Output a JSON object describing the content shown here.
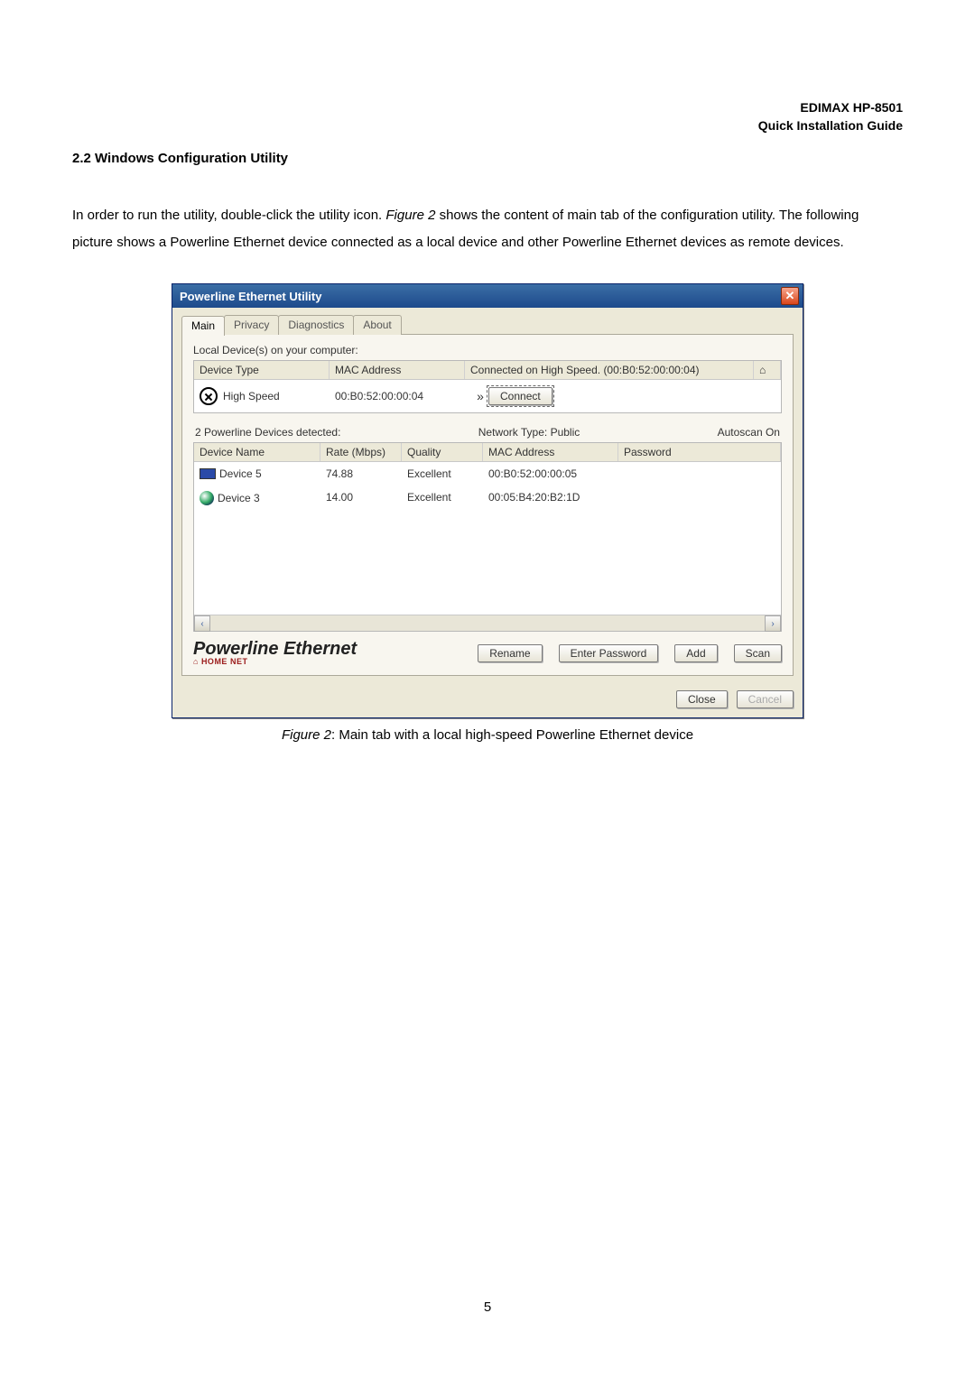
{
  "header": {
    "line1": "EDIMAX  HP-8501",
    "line2": "Quick Installation Guide"
  },
  "section_title": "2.2 Windows Configuration Utility",
  "body_before": "In order to run the utility, double-click the utility icon. ",
  "body_figref": "Figure 2",
  "body_after": " shows the content of main tab of the configuration utility. The following picture shows a Powerline Ethernet device connected as a local device and other Powerline Ethernet devices as remote devices.",
  "caption": {
    "label": "Figure 2",
    "text": ": Main tab with a local high-speed Powerline Ethernet device"
  },
  "page_number": "5",
  "dialog": {
    "title": "Powerline Ethernet Utility",
    "tabs": [
      "Main",
      "Privacy",
      "Diagnostics",
      "About"
    ],
    "local_label": "Local Device(s) on your computer:",
    "local_headers": {
      "type": "Device Type",
      "mac": "MAC Address",
      "status": "Connected on  High Speed. (00:B0:52:00:00:04)"
    },
    "local_row": {
      "type": "High Speed",
      "mac": "00:B0:52:00:00:04",
      "connect": "Connect"
    },
    "status": {
      "detected": "2 Powerline Devices detected:",
      "network": "Network Type: Public",
      "autoscan": "Autoscan On"
    },
    "det_headers": {
      "name": "Device Name",
      "rate": "Rate (Mbps)",
      "quality": "Quality",
      "mac": "MAC Address",
      "password": "Password"
    },
    "devices": [
      {
        "name": "Device 5",
        "rate": "74.88",
        "quality": "Excellent",
        "mac": "00:B0:52:00:00:05",
        "password": ""
      },
      {
        "name": "Device 3",
        "rate": "14.00",
        "quality": "Excellent",
        "mac": "00:05:B4:20:B2:1D",
        "password": ""
      }
    ],
    "brand": {
      "line1": "Powerline Ethernet",
      "line2": "HOME NET"
    },
    "buttons": {
      "rename": "Rename",
      "enter_password": "Enter Password",
      "add": "Add",
      "scan": "Scan",
      "close": "Close",
      "cancel": "Cancel"
    }
  }
}
